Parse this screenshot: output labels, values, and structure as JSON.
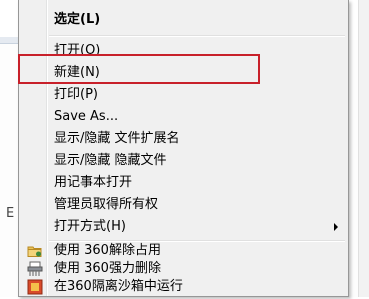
{
  "background": {
    "fragment_text": "E"
  },
  "context_menu": {
    "items": [
      {
        "label": "选定(L)",
        "bold": true
      },
      {
        "label": "打开(O)"
      },
      {
        "label": "新建(N)"
      },
      {
        "label": "打印(P)"
      },
      {
        "label": "Save As..."
      },
      {
        "label": "显示/隐藏 文件扩展名"
      },
      {
        "label": "显示/隐藏 隐藏文件"
      },
      {
        "label": "用记事本打开"
      },
      {
        "label": "管理员取得所有权"
      },
      {
        "label": "打开方式(H)",
        "has_submenu": true
      },
      {
        "label": "使用 360解除占用",
        "icon": "folder-unlock-icon"
      },
      {
        "label": "使用 360强力删除",
        "icon": "shredder-icon"
      },
      {
        "label": "在360隔离沙箱中运行",
        "icon": "sandbox-icon"
      }
    ]
  },
  "annotation": {
    "highlight_color": "#c8202a",
    "highlighted_item": "新建(N)"
  }
}
